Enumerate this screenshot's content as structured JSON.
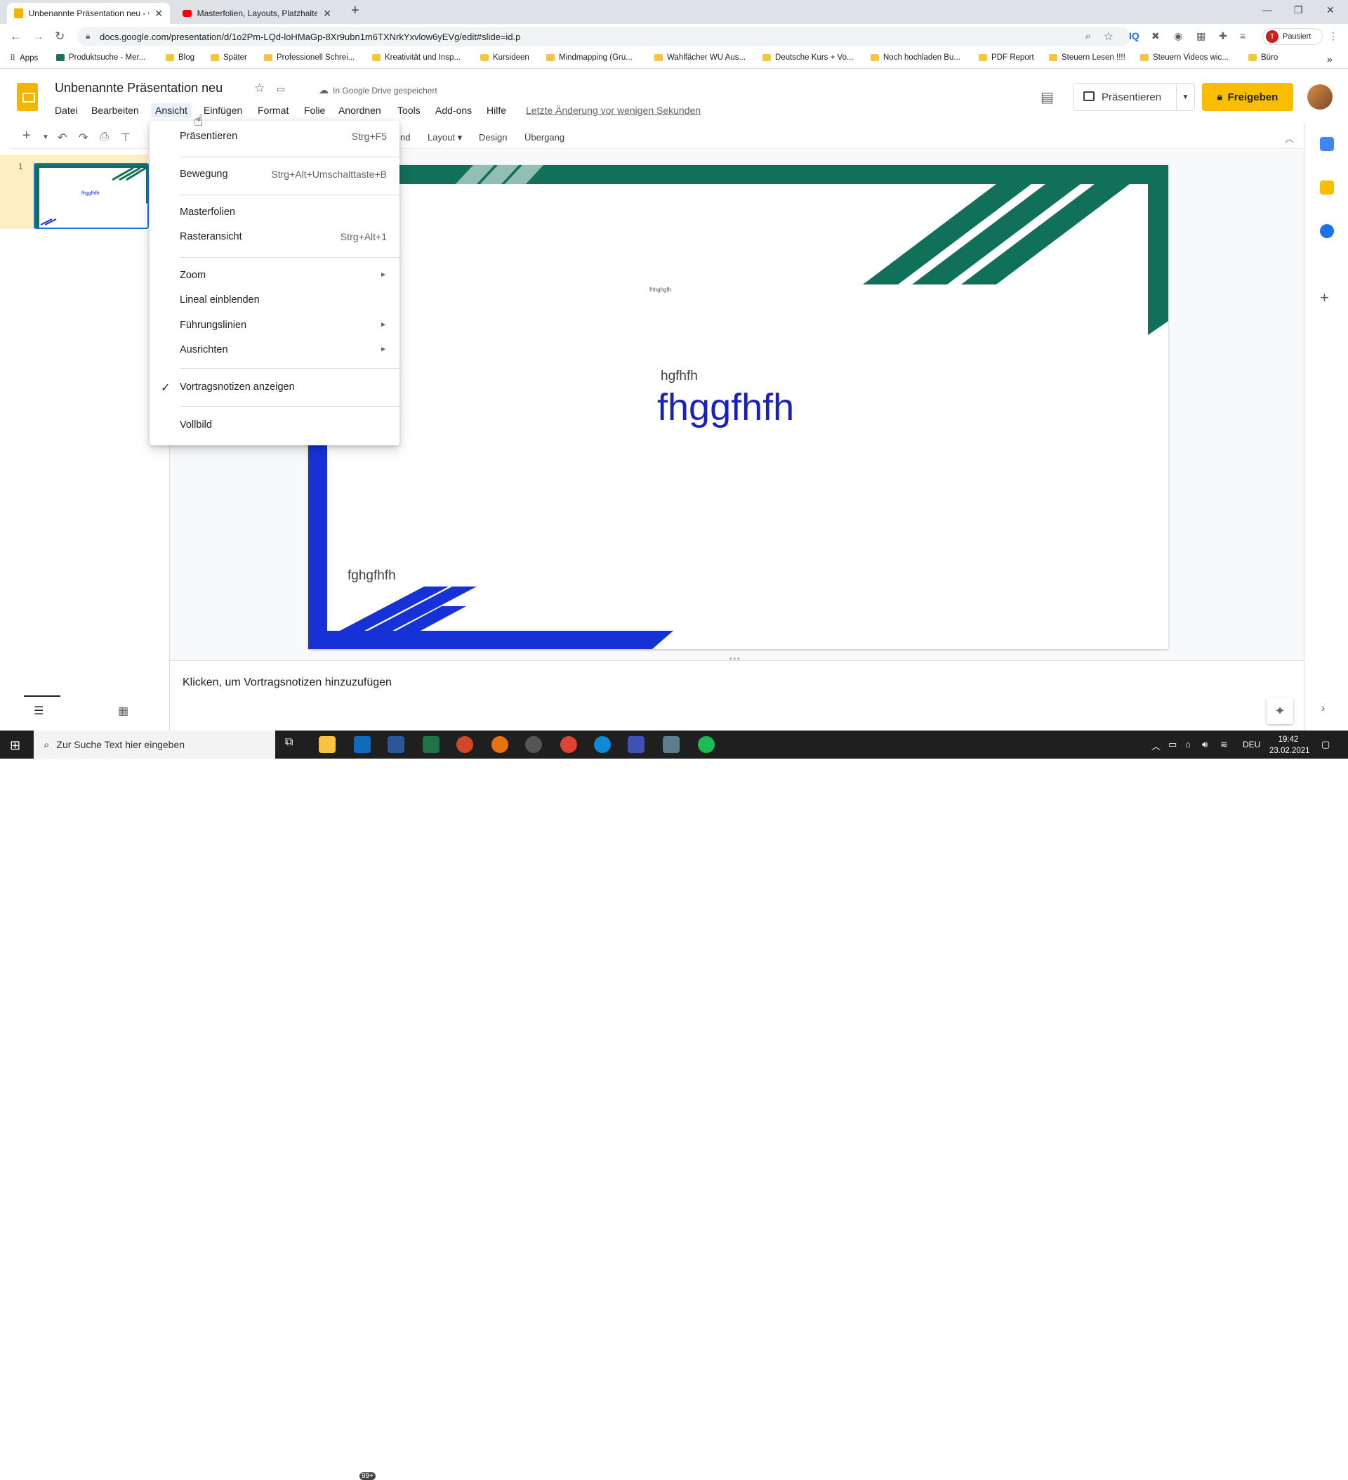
{
  "browser": {
    "tabs": [
      {
        "title": "Unbenannte Präsentation neu - Google",
        "active": true
      },
      {
        "title": "Masterfolien, Layouts, Platzhalter",
        "active": false
      }
    ],
    "url": "docs.google.com/presentation/d/1o2Pm-LQd-loHMaGp-8Xr9ubn1m6TXNrkYxvlow6yEVg/edit#slide=id.p",
    "profile_label": "Pausiert",
    "profile_initial": "T",
    "bookmarks": [
      "Apps",
      "Produktsuche - Mer...",
      "Blog",
      "Später",
      "Professionell Schrei...",
      "Kreativität und Insp...",
      "Kursideen",
      "Mindmapping (Gru...",
      "Wahlfächer WU Aus...",
      "Deutsche Kurs + Vo...",
      "Noch hochladen Bu...",
      "PDF Report",
      "Steuern Lesen !!!!",
      "Steuern Videos wic...",
      "Büro"
    ]
  },
  "app": {
    "doc_title": "Unbenannte Präsentation neu",
    "saved_status": "In Google Drive gespeichert",
    "menu": [
      "Datei",
      "Bearbeiten",
      "Ansicht",
      "Einfügen",
      "Format",
      "Folie",
      "Anordnen",
      "Tools",
      "Add-ons",
      "Hilfe"
    ],
    "last_change": "Letzte Änderung vor wenigen Sekunden",
    "present_label": "Präsentieren",
    "share_label": "Freigeben"
  },
  "toolbar": {
    "background_partial": "nd",
    "layout_label": "Layout",
    "design_label": "Design",
    "transition_label": "Übergang"
  },
  "view_menu": {
    "items": [
      {
        "label": "Präsentieren",
        "shortcut": "Strg+F5"
      },
      {
        "label": "Bewegung",
        "shortcut": "Strg+Alt+Umschalttaste+B"
      },
      {
        "label": "Masterfolien",
        "shortcut": ""
      },
      {
        "label": "Rasteransicht",
        "shortcut": "Strg+Alt+1"
      },
      {
        "label": "Zoom",
        "submenu": true
      },
      {
        "label": "Lineal einblenden",
        "shortcut": ""
      },
      {
        "label": "Führungslinien",
        "submenu": true
      },
      {
        "label": "Ausrichten",
        "submenu": true
      },
      {
        "label": "Vortragsnotizen anzeigen",
        "checked": true
      },
      {
        "label": "Vollbild",
        "shortcut": ""
      }
    ]
  },
  "filmstrip": {
    "slide_number": "1",
    "thumb_text": "fhggfhfh"
  },
  "slide": {
    "small_text": "fhhghgfh",
    "subtitle": "hgfhfh",
    "title": "fhggfhfh",
    "footer": "fghgfhfh",
    "colors": {
      "green": "#11705a",
      "blue": "#1632d6",
      "title": "#1a1fbf"
    }
  },
  "notes": {
    "placeholder": "Klicken, um Vortragsnotizen hinzuzufügen"
  },
  "taskbar": {
    "search_placeholder": "Zur Suche Text hier eingeben",
    "mail_badge": "99+",
    "language": "DEU",
    "time": "19:42",
    "date": "23.02.2021"
  }
}
